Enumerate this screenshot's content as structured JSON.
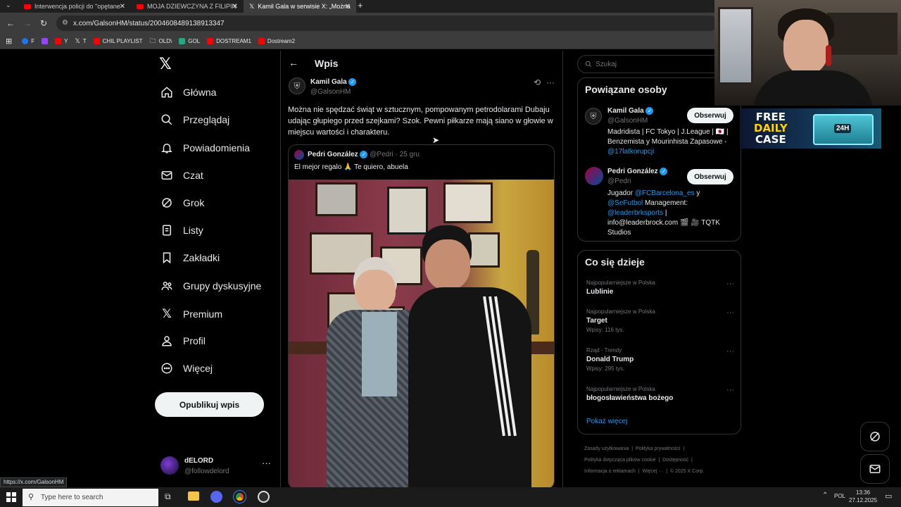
{
  "browser": {
    "tabs": [
      {
        "title": "Interwencja policji do \"opętane",
        "icon": "youtube-icon"
      },
      {
        "title": "MOJA DZIEWCZYNA Z FILIPIN",
        "icon": "youtube-icon"
      },
      {
        "title": "Kamil Gala w serwisie X: „Można",
        "icon": "x-logo-icon"
      }
    ],
    "url": "x.com/GalsonHM/status/2004608489138913347",
    "bookmarks": [
      {
        "label": "F",
        "color": "#1877f2"
      },
      {
        "label": "",
        "color": "#9146ff"
      },
      {
        "label": "Y",
        "color": "#ff0000"
      },
      {
        "label": "T",
        "color": "#ffffff"
      },
      {
        "label": "CHIL PLAYLIST",
        "color": "#ff0000"
      },
      {
        "label": "OLD\\",
        "color": "#aaaaaa"
      },
      {
        "label": "GOL",
        "color": "#22aa88"
      },
      {
        "label": "DOSTREAM1",
        "color": "#ff0000"
      },
      {
        "label": "Dostream2",
        "color": "#ff0000"
      }
    ],
    "status_url": "https://x.com/GalsonHM"
  },
  "nav": {
    "items": [
      {
        "label": "Główna",
        "icon": "home-icon"
      },
      {
        "label": "Przeglądaj",
        "icon": "search-icon"
      },
      {
        "label": "Powiadomienia",
        "icon": "bell-icon"
      },
      {
        "label": "Czat",
        "icon": "envelope-icon"
      },
      {
        "label": "Grok",
        "icon": "grok-icon"
      },
      {
        "label": "Listy",
        "icon": "list-icon"
      },
      {
        "label": "Zakładki",
        "icon": "bookmark-icon"
      },
      {
        "label": "Grupy dyskusyjne",
        "icon": "people-icon"
      },
      {
        "label": "Premium",
        "icon": "x-logo-icon"
      },
      {
        "label": "Profil",
        "icon": "person-icon"
      },
      {
        "label": "Więcej",
        "icon": "more-circle-icon"
      }
    ],
    "post_button": "Opublikuj wpis",
    "account": {
      "name": "dELORD",
      "handle": "@followdelord"
    }
  },
  "main": {
    "header": "Wpis",
    "post": {
      "author": "Kamil Gala",
      "handle": "@GalsonHM",
      "text": "Można nie spędzać świąt w sztucznym, pompowanym petrodolarami Dubaju udając głupiego przed szejkami? Szok. Pewni piłkarze mają siano w głowie w miejscu wartości i charakteru.",
      "quote": {
        "author": "Pedri González",
        "handle": "@Pedri",
        "date": "· 25 gru",
        "text": "El mejor regalo 🙏 Te quiero, abuela"
      }
    }
  },
  "right": {
    "search_placeholder": "Szukaj",
    "related": {
      "title": "Powiązane osoby",
      "people": [
        {
          "name": "Kamil Gala",
          "handle": "@GalsonHM",
          "bio": "Madridista | FC Tokyo | J.League | 🇯🇵 | Benzemista y Mourinhista Zapasowe -",
          "bio_link": "@17latkorupcji",
          "follow": "Obserwuj"
        },
        {
          "name": "Pedri González",
          "handle": "@Pedri",
          "bio_1": "Jugador",
          "link_1": "@FCBarcelona_es",
          "bio_2": "y",
          "link_2": "@SeFutbol",
          "bio_3": "Management:",
          "link_3": "@leaderbrksports",
          "bio_4": "|",
          "bio_5": "info@leaderbrock.com 🎬 🎥 TQTK Studios",
          "follow": "Obserwuj"
        }
      ]
    },
    "trends": {
      "title": "Co się dzieje",
      "items": [
        {
          "context": "Najpopularniejsze w Polska",
          "title": "Lublinie",
          "count": ""
        },
        {
          "context": "Najpopularniejsze w Polska",
          "title": "Target",
          "count": "Wpisy: 116 tys."
        },
        {
          "context": "Rząd · Trendy",
          "title": "Donald Trump",
          "count": "Wpisy: 295 tys."
        },
        {
          "context": "Najpopularniejsze w Polska",
          "title": "błogosławieństwa bożego",
          "count": ""
        }
      ],
      "show_more": "Pokaż więcej"
    },
    "footer": {
      "l1a": "Zasady użytkowania",
      "l1b": "Polityka prywatności",
      "l2a": "Polityka dotycząca plików cookie",
      "l2b": "Dostępność",
      "l3a": "Informacja o reklamach",
      "l3b": "Więcej ···",
      "l3c": "© 2025 X Corp."
    }
  },
  "overlay": {
    "ad_line1": "FREE",
    "ad_line2": "DAILY",
    "ad_line3": "CASE",
    "ad_badge": "24H"
  },
  "taskbar": {
    "search_placeholder": "Type here to search",
    "language": "POL",
    "time": "13:36",
    "date": "27.12.2025"
  }
}
